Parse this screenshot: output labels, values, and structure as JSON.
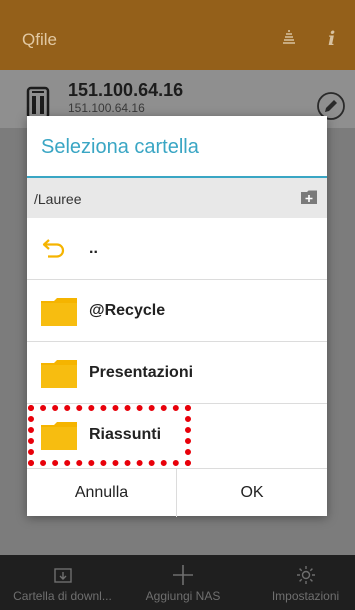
{
  "app": {
    "title": "Qfile",
    "icons": {
      "stack": "stack-icon",
      "info": "info-icon"
    },
    "colors": {
      "appbar": "#94601a",
      "accent": "#3aa6c4",
      "folder": "#f5b400",
      "highlight": "#e8000a"
    }
  },
  "nas": {
    "ip": "151.100.64.16",
    "ip_sub": "151.100.64.16"
  },
  "dialog": {
    "title": "Seleziona cartella",
    "path": "/Lauree",
    "rows": [
      {
        "label": "..",
        "icon": "back-arrow-icon"
      },
      {
        "label": "@Recycle",
        "icon": "folder-icon"
      },
      {
        "label": "Presentazioni",
        "icon": "folder-icon"
      },
      {
        "label": "Riassunti",
        "icon": "folder-icon"
      }
    ],
    "cancel_label": "Annulla",
    "ok_label": "OK"
  },
  "bottombar": {
    "download_label": "Cartella di downl...",
    "add_label": "Aggiungi NAS",
    "settings_label": "Impostazioni"
  }
}
